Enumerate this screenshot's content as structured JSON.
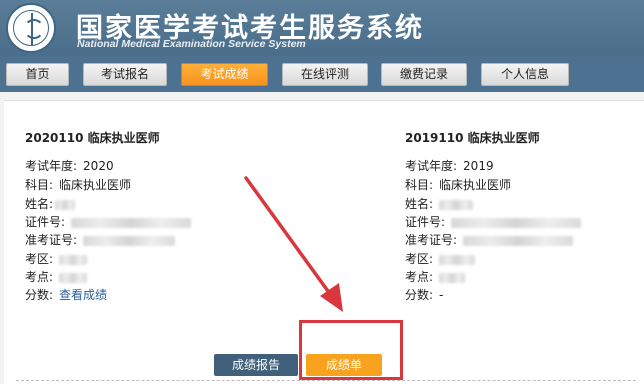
{
  "header": {
    "title_cn": "国家医学考试考生服务系统",
    "title_en": "National Medical Examination Service System",
    "logo_icon": "medical-caduceus-logo"
  },
  "nav": {
    "items": [
      {
        "label": "首页"
      },
      {
        "label": "考试报名"
      },
      {
        "label": "考试成绩",
        "active": true
      },
      {
        "label": "在线评测"
      },
      {
        "label": "缴费记录"
      },
      {
        "label": "个人信息"
      }
    ]
  },
  "cards": [
    {
      "title": "2020110  临床执业医师",
      "fields": {
        "year_label": "考试年度:",
        "year_value": "2020",
        "subject_label": "科目:",
        "subject_value": "临床执业医师",
        "name_label": "姓名:",
        "id_label": "证件号:",
        "ticket_label": "准考证号:",
        "region_label": "考区:",
        "site_label": "考点:",
        "score_label": "分数:",
        "score_value": "查看成绩"
      }
    },
    {
      "title": "2019110  临床执业医师",
      "fields": {
        "year_label": "考试年度:",
        "year_value": "2019",
        "subject_label": "科目:",
        "subject_value": "临床执业医师",
        "name_label": "姓名:",
        "id_label": "证件号:",
        "ticket_label": "准考证号:",
        "region_label": "考区:",
        "site_label": "考点:",
        "score_label": "分数:",
        "score_value": "-"
      }
    }
  ],
  "actions": {
    "report_label": "成绩报告",
    "sheet_label": "成绩单"
  },
  "colors": {
    "header_bg": "#4d7190",
    "active_tab": "#f7931e",
    "report_button": "#3f5f7a",
    "sheet_button": "#f8a21e",
    "annotation_red": "#d9363e",
    "link": "#2a5d9b"
  }
}
